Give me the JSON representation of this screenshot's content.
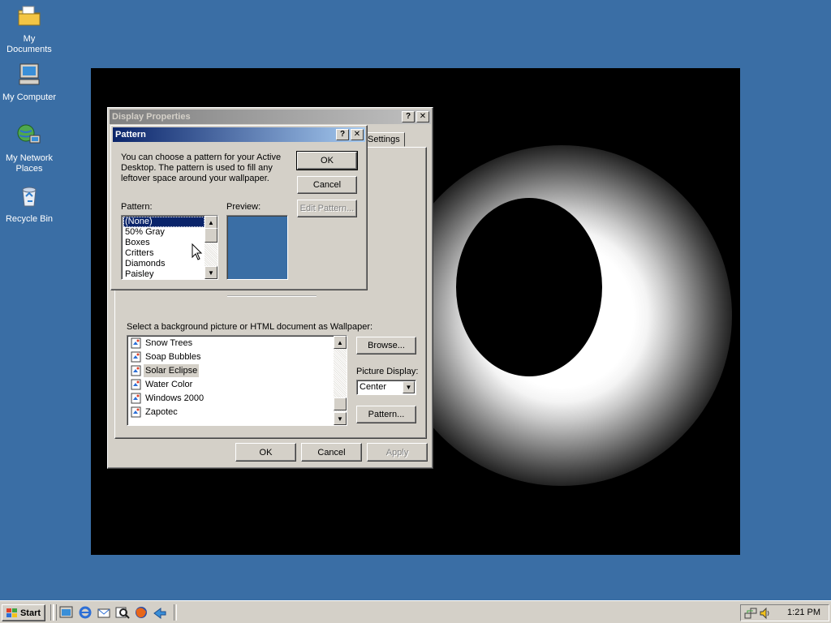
{
  "desktop": {
    "icons": [
      {
        "label": "My Documents",
        "icon": "folder-icon"
      },
      {
        "label": "My Computer",
        "icon": "computer-icon"
      },
      {
        "label": "My Network Places",
        "icon": "network-icon"
      },
      {
        "label": "Recycle Bin",
        "icon": "recycle-bin-icon"
      }
    ],
    "background_color": "#3a6ea5"
  },
  "display_properties": {
    "title": "Display Properties",
    "visible_tab": "Settings",
    "wallpaper_label": "Select a background picture or HTML document as Wallpaper:",
    "wallpapers": [
      "Snow Trees",
      "Soap Bubbles",
      "Solar Eclipse",
      "Water Color",
      "Windows 2000",
      "Zapotec"
    ],
    "selected_wallpaper": "Solar Eclipse",
    "browse_label": "Browse...",
    "picture_display_label": "Picture Display:",
    "picture_display_value": "Center",
    "pattern_button_label": "Pattern...",
    "ok_label": "OK",
    "cancel_label": "Cancel",
    "apply_label": "Apply"
  },
  "pattern_dialog": {
    "title": "Pattern",
    "description_line1": "You can choose a pattern for your Active",
    "description_line2": "Desktop.  The pattern is used to fill any",
    "description_line3": "leftover space around your wallpaper.",
    "pattern_label": "Pattern:",
    "preview_label": "Preview:",
    "patterns": [
      "(None)",
      "50% Gray",
      "Boxes",
      "Critters",
      "Diamonds",
      "Paisley"
    ],
    "selected_pattern": "(None)",
    "preview_color": "#3a6ea5",
    "ok_label": "OK",
    "cancel_label": "Cancel",
    "edit_pattern_label": "Edit Pattern..."
  },
  "taskbar": {
    "start_label": "Start",
    "clock": "1:21 PM",
    "quick_launch": [
      "show-desktop-icon",
      "internet-explorer-icon",
      "outlook-express-icon",
      "search-icon",
      "firefox-icon",
      "arrow-icon"
    ]
  },
  "title_buttons": {
    "help": "?",
    "close": "✕"
  }
}
